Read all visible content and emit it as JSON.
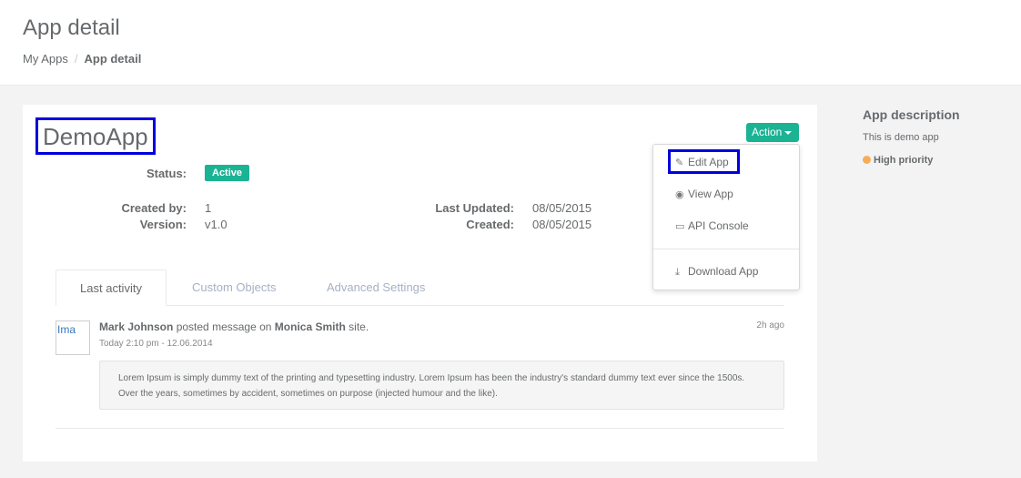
{
  "header": {
    "title": "App detail",
    "breadcrumb": {
      "parent": "My Apps",
      "separator": "/",
      "current": "App detail"
    }
  },
  "app": {
    "name": "DemoApp",
    "status_label": "Status:",
    "status": "Active",
    "created_by_label": "Created by:",
    "created_by": "1",
    "version_label": "Version:",
    "version": "v1.0",
    "last_updated_label": "Last Updated:",
    "last_updated": "08/05/2015",
    "created_label": "Created:",
    "created": "08/05/2015"
  },
  "action_menu": {
    "button_label": "Action",
    "items": [
      {
        "label": "Edit App",
        "icon": "edit-icon"
      },
      {
        "label": "View App",
        "icon": "eye-icon"
      },
      {
        "label": "API Console",
        "icon": "monitor-icon"
      },
      {
        "label": "Download App",
        "icon": "download-icon"
      }
    ]
  },
  "tabs": [
    {
      "label": "Last activity",
      "active": true
    },
    {
      "label": "Custom Objects",
      "active": false
    },
    {
      "label": "Advanced Settings",
      "active": false
    }
  ],
  "activity": {
    "avatar_alt": "Ima",
    "user": "Mark Johnson",
    "action_text": "posted message on",
    "target": "Monica Smith",
    "target_suffix": "site.",
    "timestamp": "Today 2:10 pm - 12.06.2014",
    "ago": "2h ago",
    "message": "Lorem Ipsum is simply dummy text of the printing and typesetting industry. Lorem Ipsum has been the industry's standard dummy text ever since the 1500s. Over the years, sometimes by accident, sometimes on purpose (injected humour and the like)."
  },
  "sidebar": {
    "title": "App description",
    "description": "This is demo app",
    "priority": "High priority",
    "priority_color": "#f8ac59"
  },
  "colors": {
    "accent": "#1ab394",
    "highlight_border": "#0000dd"
  }
}
